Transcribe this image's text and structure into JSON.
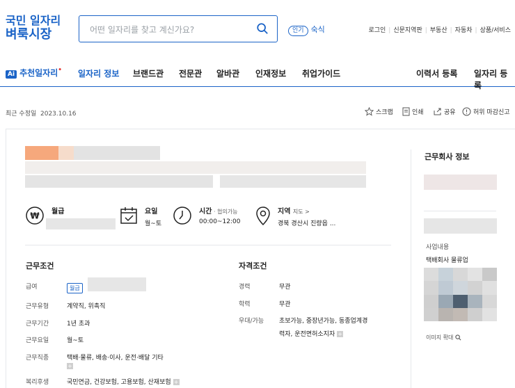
{
  "logo": {
    "line1": "국민 일자리",
    "line2": "벼룩시장"
  },
  "search": {
    "placeholder": "어떤 일자리를 찾고 계신가요?"
  },
  "popular": {
    "badge": "인기",
    "keyword": "숙식"
  },
  "util_links": [
    "로그인",
    "신문지역판",
    "부동산",
    "자동차",
    "상품/서비스"
  ],
  "nav": {
    "ai_badge": "Ai",
    "ai_label": "추천일자리",
    "items": [
      "일자리 정보",
      "브랜드관",
      "전문관",
      "알바관",
      "인재정보",
      "취업가이드"
    ],
    "right": [
      "이력서 등록",
      "일자리 등록"
    ]
  },
  "meta": {
    "modified_label": "최근 수정일",
    "modified_date": "2023.10.16"
  },
  "actions": [
    "스크랩",
    "인쇄",
    "공유",
    "허위 마감신고"
  ],
  "info": {
    "salary_title": "월급",
    "day_title": "요일",
    "day_value": "월~토",
    "time_title": "시간",
    "time_note": "협의가능",
    "time_value": "00:00~12:00",
    "region_title": "지역",
    "region_map": "지도 >",
    "region_value": "경북 경산시 진량읍 ..."
  },
  "conditions": {
    "title": "근무조건",
    "salary_label": "급여",
    "salary_tag": "월급",
    "type_label": "근무유형",
    "type_value": "계약직, 위촉직",
    "period_label": "근무기간",
    "period_value": "1년 초과",
    "days_label": "근무요일",
    "days_value": "월~토",
    "job_label": "근무직종",
    "job_value": "택배·물류, 배송·이사, 운전·배달 기타",
    "welfare_label": "복리후생",
    "welfare_value": "국민연금, 건강보험, 고용보험, 산재보험"
  },
  "qualifications": {
    "title": "자격조건",
    "career_label": "경력",
    "career_value": "무관",
    "edu_label": "학력",
    "edu_value": "무관",
    "pref_label": "우대/가능",
    "pref_value1": "초보가능, 중장년가능, 동종업계경",
    "pref_value2": "력자, 운전면허소지자"
  },
  "company": {
    "title": "근무회사 정보",
    "business_label": "사업내용",
    "business_value": "택배회사 물류업",
    "zoom_label": "이미지 확대"
  },
  "colors": {
    "accent": "#1a63c7"
  }
}
